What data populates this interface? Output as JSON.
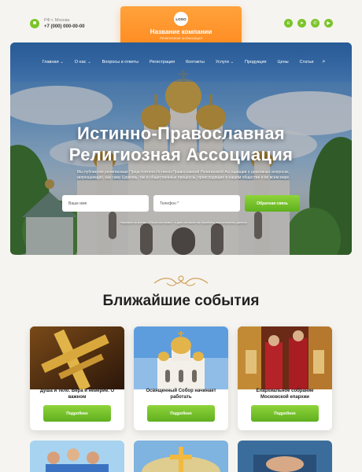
{
  "header": {
    "city": "РФ г. Москва",
    "phone": "+7 (000) 000-00-00",
    "logo_text": "LOGO",
    "company_name": "Название компании",
    "company_sub": "Религиозная организация",
    "socials": [
      "vk-icon",
      "telegram-icon",
      "whatsapp-icon",
      "youtube-icon"
    ],
    "accent": "#7cc42a",
    "brand_color": "#ff8a1f"
  },
  "nav": {
    "items": [
      {
        "label": "Главная",
        "dropdown": true
      },
      {
        "label": "О нас",
        "dropdown": true
      },
      {
        "label": "Вопросы и ответы",
        "dropdown": false
      },
      {
        "label": "Регистрация",
        "dropdown": false
      },
      {
        "label": "Контакты",
        "dropdown": false
      },
      {
        "label": "Услуги",
        "dropdown": true
      },
      {
        "label": "Продукция",
        "dropdown": false
      },
      {
        "label": "Цены",
        "dropdown": false
      },
      {
        "label": "Статьи",
        "dropdown": false
      }
    ]
  },
  "hero": {
    "title_line1": "Истинно-Православная",
    "title_line2": "Религиозная Ассоциация",
    "description": "Мы публикуем религиозные Предстоятеля Истинно-Православной Религиозной Ассоциации о церковных вопросах, запрещающих, как саму Церковь, так и общественные процессы, происходящие в нашем обществе и во всем мире.",
    "name_placeholder": "Ваше имя",
    "phone_placeholder": "Телефон *",
    "submit_label": "Обратная связь",
    "consent": "Нажимая на кнопку «Обратная связь», я даю согласие на обработку персональных данных"
  },
  "events": {
    "title": "Ближайшие события",
    "cards": [
      {
        "title": "Душа и тело. Вера и неверие. О важном",
        "button": "Подробнее"
      },
      {
        "title": "Освященный Собор начинает работать",
        "button": "Подробнее"
      },
      {
        "title": "Епархиальное собрание Московской епархии",
        "button": "Подробнее"
      }
    ]
  }
}
